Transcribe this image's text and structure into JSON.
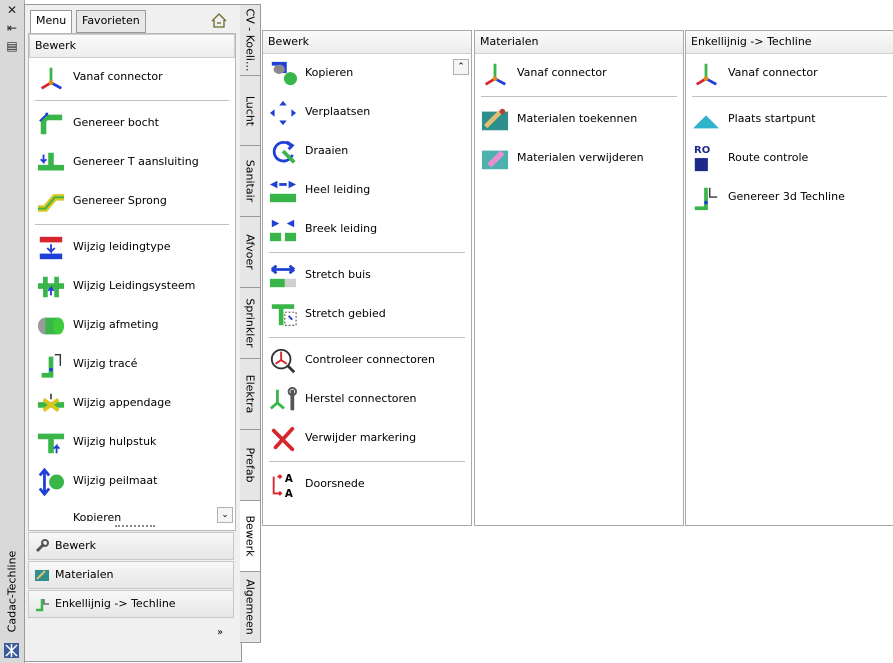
{
  "window": {
    "title": "Cadac-Techline",
    "close_glyph": "✕",
    "pin_glyph": "⇤",
    "menu_glyph": "▤"
  },
  "top_tabs": [
    {
      "label": "Menu",
      "active": true
    },
    {
      "label": "Favorieten",
      "active": false
    }
  ],
  "main_section": {
    "title": "Bewerk",
    "groups": [
      [
        {
          "label": "Vanaf connector",
          "icon": "connector-axes-icon"
        }
      ],
      [
        {
          "label": "Genereer bocht",
          "icon": "pipe-bend-icon"
        },
        {
          "label": "Genereer T aansluiting",
          "icon": "pipe-tee-icon"
        },
        {
          "label": "Genereer Sprong",
          "icon": "pipe-jump-icon"
        }
      ],
      [
        {
          "label": "Wijzig leidingtype",
          "icon": "pipe-type-icon"
        },
        {
          "label": "Wijzig Leidingsysteem",
          "icon": "pipe-system-icon"
        },
        {
          "label": "Wijzig afmeting",
          "icon": "pipe-size-icon"
        },
        {
          "label": "Wijzig tracé",
          "icon": "pipe-route-icon"
        },
        {
          "label": "Wijzig appendage",
          "icon": "pipe-valve-icon"
        },
        {
          "label": "Wijzig hulpstuk",
          "icon": "pipe-fitting-icon"
        },
        {
          "label": "Wijzig peilmaat",
          "icon": "level-arrow-icon"
        }
      ]
    ],
    "partial_item": "Kopieren"
  },
  "bottom_items": [
    {
      "label": "Bewerk",
      "icon": "wrench-icon"
    },
    {
      "label": "Materialen",
      "icon": "materials-icon"
    },
    {
      "label": "Enkellijnig -> Techline",
      "icon": "techline-icon"
    }
  ],
  "vertical_tabs": [
    {
      "label": "CV - Koeli...",
      "active": false
    },
    {
      "label": "Lucht",
      "active": false
    },
    {
      "label": "Sanitair",
      "active": false
    },
    {
      "label": "Afvoer",
      "active": false
    },
    {
      "label": "Sprinkler",
      "active": false
    },
    {
      "label": "Elektra",
      "active": false
    },
    {
      "label": "Prefab",
      "active": false
    },
    {
      "label": "Bewerk",
      "active": true
    },
    {
      "label": "Algemeen",
      "active": false
    }
  ],
  "panels": [
    {
      "title": "Bewerk",
      "groups": [
        [
          {
            "label": "Kopieren",
            "icon": "copy-icon"
          },
          {
            "label": "Verplaatsen",
            "icon": "move-icon"
          },
          {
            "label": "Draaien",
            "icon": "rotate-icon"
          },
          {
            "label": "Heel leiding",
            "icon": "join-pipe-icon"
          },
          {
            "label": "Breek leiding",
            "icon": "break-pipe-icon"
          }
        ],
        [
          {
            "label": "Stretch buis",
            "icon": "stretch-pipe-icon"
          },
          {
            "label": "Stretch gebied",
            "icon": "stretch-area-icon"
          }
        ],
        [
          {
            "label": "Controleer connectoren",
            "icon": "check-connector-icon"
          },
          {
            "label": "Herstel connectoren",
            "icon": "repair-connector-icon"
          },
          {
            "label": "Verwijder markering",
            "icon": "delete-marker-icon"
          }
        ],
        [
          {
            "label": "Doorsnede",
            "icon": "section-icon"
          }
        ]
      ]
    },
    {
      "title": "Materialen",
      "groups": [
        [
          {
            "label": "Vanaf connector",
            "icon": "connector-axes-icon"
          }
        ],
        [
          {
            "label": "Materialen toekennen",
            "icon": "assign-material-icon"
          },
          {
            "label": "Materialen verwijderen",
            "icon": "remove-material-icon"
          }
        ]
      ]
    },
    {
      "title": "Enkellijnig -> Techline",
      "groups": [
        [
          {
            "label": "Vanaf connector",
            "icon": "connector-axes-icon"
          }
        ],
        [
          {
            "label": "Plaats startpunt",
            "icon": "start-point-icon"
          },
          {
            "label": "Route controle",
            "icon": "route-check-icon",
            "icon_text": "RO"
          },
          {
            "label": "Genereer 3d Techline",
            "icon": "techline-3d-icon"
          }
        ]
      ]
    }
  ]
}
